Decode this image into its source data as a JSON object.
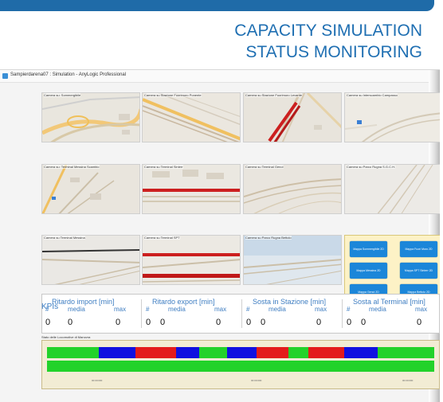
{
  "slide": {
    "title_line1": "CAPACITY SIMULATION",
    "title_line2": "STATUS MONITORING"
  },
  "window": {
    "title": "Sampierdarena07 : Simulation - AnyLogic Professional"
  },
  "cameras": [
    {
      "label": "Camera su: Sommergibile"
    },
    {
      "label": "Camera su Stazione Fuorimuro Ponente"
    },
    {
      "label": "Camera su Stazione Fuorimuro Levante"
    },
    {
      "label": "Camera su Interscambio Campasso"
    },
    {
      "label": "Camera su: Terminal Messina Scambio"
    },
    {
      "label": "Camera su Terminal Sinterr"
    },
    {
      "label": "Camera su Terminal Genoi"
    },
    {
      "label": "Camera su Parco Rugna S.G.C.H."
    },
    {
      "label": "Camera su Terminal Messina"
    },
    {
      "label": "Camera su Terminal SPT"
    },
    {
      "label": "Camera su Parco Rugna Bettolo"
    }
  ],
  "map_buttons": [
    {
      "label": "Mappa Sommergibile 2D"
    },
    {
      "label": "Mappa Fuori Muro 2D"
    },
    {
      "label": "Mappa Messina 2D"
    },
    {
      "label": "Mappa SPT Sinterr 2D"
    },
    {
      "label": "Mappa Genoi 2D"
    },
    {
      "label": "Mappa Bettolo 2D"
    }
  ],
  "kpis": {
    "title": "KPIs",
    "items": [
      {
        "name": "Ritardo import  [min]",
        "hash": "#",
        "media": "media",
        "max": "max",
        "count_value": "0",
        "media_value": "0",
        "max_value": "0"
      },
      {
        "name": "Ritardo export  [min]",
        "hash": "#",
        "media": "media",
        "max": "max",
        "count_value": "0",
        "media_value": "0",
        "max_value": "0"
      },
      {
        "name": "Sosta in Stazione  [min]",
        "hash": "#",
        "media": "media",
        "max": "max",
        "count_value": "0",
        "media_value": "0",
        "max_value": "0"
      },
      {
        "name": "Sosta al Terminal  [min]",
        "hash": "#",
        "media": "media",
        "max": "max",
        "count_value": "0",
        "media_value": "0",
        "max_value": "0"
      }
    ]
  },
  "gantt": {
    "label": "Stato delle Locomotive di Manovra",
    "colors": {
      "idle": "#22d22a",
      "moving": "#1010e0",
      "busy": "#e31b1b"
    },
    "row1": [
      {
        "state": "idle",
        "from": 0.0,
        "to": 0.134
      },
      {
        "state": "moving",
        "from": 0.134,
        "to": 0.228
      },
      {
        "state": "busy",
        "from": 0.228,
        "to": 0.334
      },
      {
        "state": "moving",
        "from": 0.334,
        "to": 0.392
      },
      {
        "state": "idle",
        "from": 0.392,
        "to": 0.466
      },
      {
        "state": "moving",
        "from": 0.466,
        "to": 0.542
      },
      {
        "state": "busy",
        "from": 0.542,
        "to": 0.623
      },
      {
        "state": "idle",
        "from": 0.623,
        "to": 0.674
      },
      {
        "state": "busy",
        "from": 0.674,
        "to": 0.768
      },
      {
        "state": "moving",
        "from": 0.768,
        "to": 0.853
      },
      {
        "state": "idle",
        "from": 0.853,
        "to": 1.0
      }
    ],
    "row2": [
      {
        "state": "idle",
        "from": 0.0,
        "to": 1.0
      }
    ],
    "ticks": [
      "00:00:000",
      "00:00:000",
      "00:00:000"
    ]
  }
}
